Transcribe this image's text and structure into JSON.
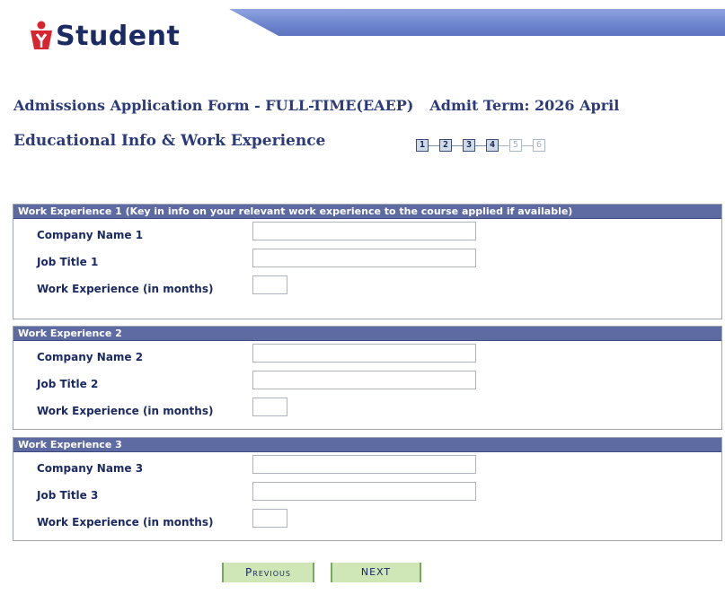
{
  "brand": {
    "logo_text": "Student"
  },
  "form": {
    "title": "Admissions Application Form - FULL-TIME(EAEP)",
    "admit_term": "Admit Term: 2026 April",
    "section_title": "Educational Info & Work Experience",
    "steps": [
      {
        "label": "1",
        "state": "completed"
      },
      {
        "label": "2",
        "state": "completed"
      },
      {
        "label": "3",
        "state": "completed"
      },
      {
        "label": "4",
        "state": "current"
      },
      {
        "label": "5",
        "state": "pending"
      },
      {
        "label": "6",
        "state": "pending"
      }
    ]
  },
  "groups": [
    {
      "header": "Work Experience 1 (Key in info on your relevant work experience to the course applied if available)",
      "company_label": "Company Name 1",
      "company_value": "",
      "job_label": "Job Title 1",
      "job_value": "",
      "months_label": "Work Experience (in months)",
      "months_value": ""
    },
    {
      "header": "Work Experience 2",
      "company_label": "Company Name 2",
      "company_value": "",
      "job_label": "Job Title 2",
      "job_value": "",
      "months_label": "Work Experience (in months)",
      "months_value": ""
    },
    {
      "header": "Work Experience 3",
      "company_label": "Company Name 3",
      "company_value": "",
      "job_label": "Job Title 3",
      "job_value": "",
      "months_label": "Work Experience (in months)",
      "months_value": ""
    }
  ],
  "buttons": {
    "previous": "Previous",
    "next": "NEXT"
  },
  "colors": {
    "group_header_bg": "#5e6aa2",
    "button_bg": "#cfe6b6",
    "logo_red": "#d9232e",
    "text_navy": "#1b2a63"
  }
}
